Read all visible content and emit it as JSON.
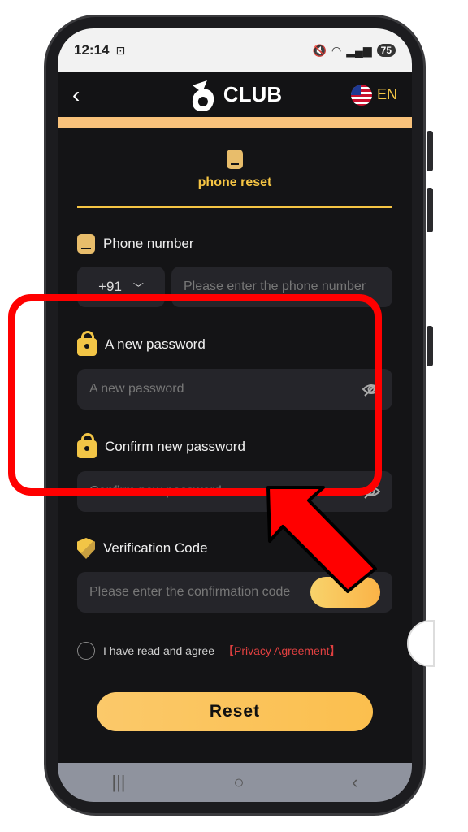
{
  "status": {
    "time": "12:14",
    "battery": "75"
  },
  "header": {
    "brand": "CLUB",
    "language": "EN"
  },
  "tab": {
    "label": "phone reset"
  },
  "phone": {
    "label": "Phone number",
    "country_code": "+91",
    "placeholder": "Please enter the phone number"
  },
  "new_password": {
    "label": "A new password",
    "placeholder": "A new password"
  },
  "confirm_password": {
    "label": "Confirm new password",
    "placeholder": "Confirm new password"
  },
  "verification": {
    "label": "Verification Code",
    "placeholder": "Please enter the confirmation code"
  },
  "agree": {
    "text": "I have read and agree",
    "link": "【Privacy Agreement】"
  },
  "reset_label": "Reset",
  "colors": {
    "accent": "#f6c544",
    "highlight": "#ff0000",
    "button": "#fbc96a"
  }
}
